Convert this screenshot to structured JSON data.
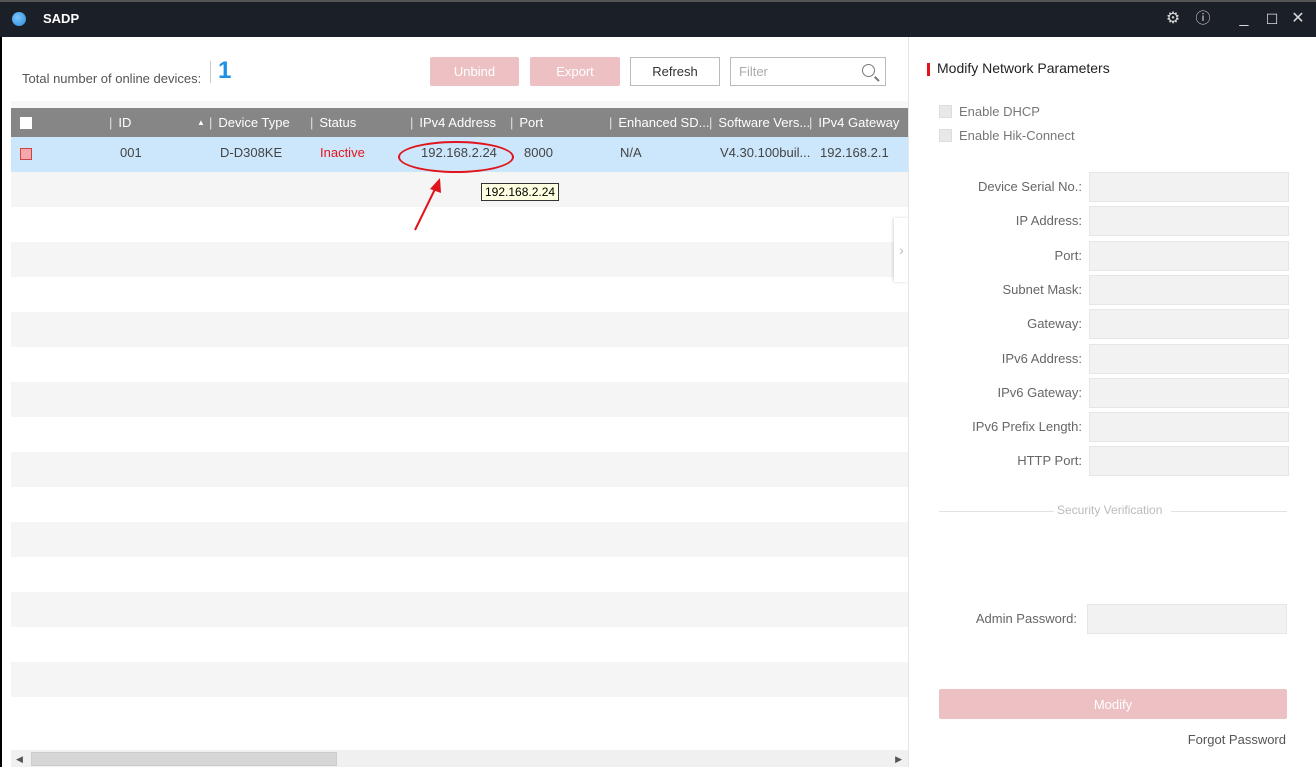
{
  "window": {
    "title": "SADP",
    "controls": [
      "settings",
      "about",
      "minimize",
      "maximize",
      "close"
    ]
  },
  "toolbar": {
    "count_label": "Total number of online devices:",
    "count_value": "1",
    "unbind_label": "Unbind",
    "export_label": "Export",
    "refresh_label": "Refresh",
    "filter_placeholder": "Filter",
    "filter_value": ""
  },
  "table": {
    "columns": [
      "ID",
      "Device Type",
      "Status",
      "IPv4 Address",
      "Port",
      "Enhanced SD...",
      "Software Vers...",
      "IPv4 Gateway"
    ],
    "sorted_column": "ID",
    "rows": [
      {
        "id": "001",
        "device_type": "D-D308KE",
        "status": "Inactive",
        "ipv4": "192.168.2.24",
        "port": "8000",
        "enhanced_sdk": "N/A",
        "software_version": "V4.30.100buil...",
        "ipv4_gateway": "192.168.2.1",
        "selected": true
      }
    ],
    "tooltip": "192.168.2.24"
  },
  "panel": {
    "title": "Modify Network Parameters",
    "checkboxes": [
      {
        "label": "Enable DHCP",
        "checked": false
      },
      {
        "label": "Enable Hik-Connect",
        "checked": false
      }
    ],
    "fields": [
      {
        "label": "Device Serial No.:",
        "value": ""
      },
      {
        "label": "IP Address:",
        "value": ""
      },
      {
        "label": "Port:",
        "value": ""
      },
      {
        "label": "Subnet Mask:",
        "value": ""
      },
      {
        "label": "Gateway:",
        "value": ""
      },
      {
        "label": "IPv6 Address:",
        "value": ""
      },
      {
        "label": "IPv6 Gateway:",
        "value": ""
      },
      {
        "label": "IPv6 Prefix Length:",
        "value": ""
      },
      {
        "label": "HTTP Port:",
        "value": ""
      }
    ],
    "security_label": "Security Verification",
    "admin_password_label": "Admin Password:",
    "admin_password_value": "",
    "modify_label": "Modify",
    "forgot_label": "Forgot Password"
  },
  "colors": {
    "accent_red": "#e0141c",
    "count_blue": "#1e90e6",
    "disabled_button": "#edc1c3",
    "selected_row": "#cce6fb",
    "header_gray": "#868686"
  }
}
